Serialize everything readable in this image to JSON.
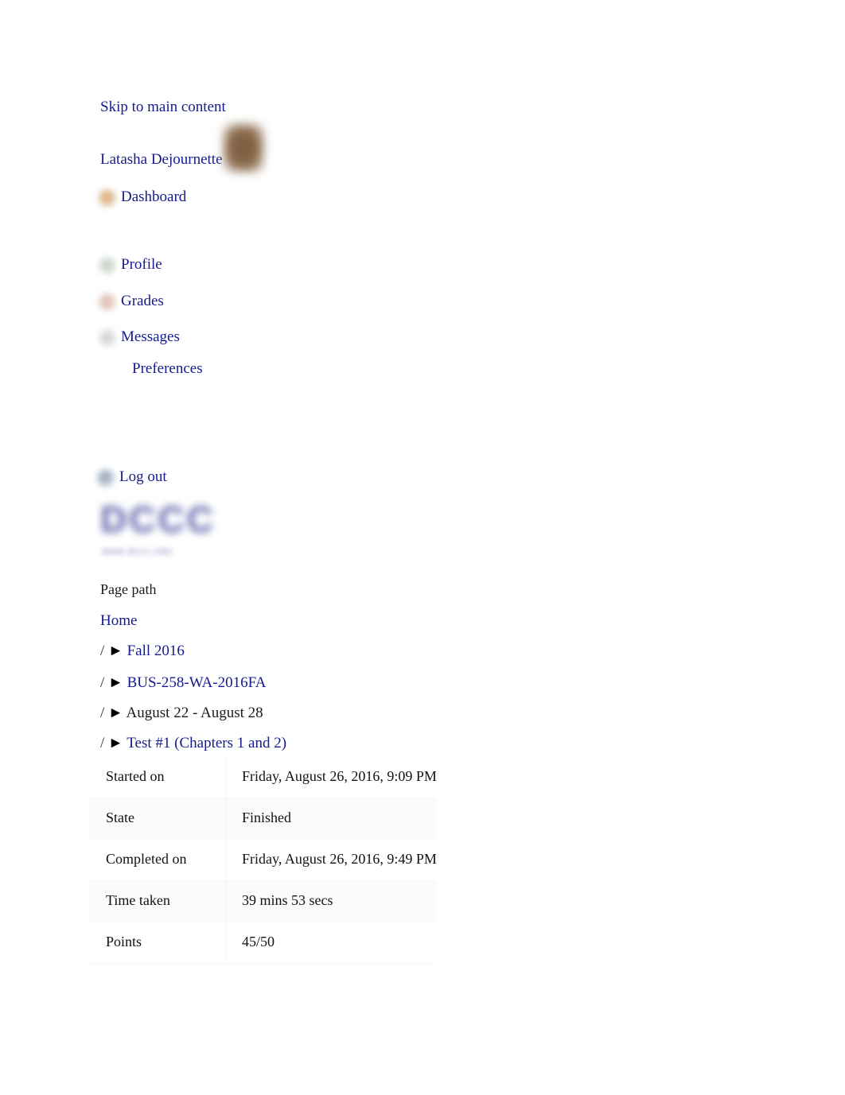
{
  "skip_link": "Skip to main content",
  "user": {
    "name": "Latasha Dejournette",
    "avatar_alt": "user-avatar"
  },
  "nav": {
    "dashboard": "Dashboard",
    "profile": "Profile",
    "grades": "Grades",
    "messages": "Messages",
    "preferences": "Preferences",
    "logout": "Log out"
  },
  "logo": {
    "wordmark": "DCCC",
    "tagline": "www.dccc.edu"
  },
  "breadcrumb": {
    "label": "Page path",
    "items": [
      {
        "sep": "",
        "arrow": "",
        "text": "Home",
        "is_link": true
      },
      {
        "sep": "/",
        "arrow": "►",
        "text": "Fall 2016",
        "is_link": true
      },
      {
        "sep": "/",
        "arrow": "►",
        "text": "BUS-258-WA-2016FA",
        "is_link": true
      },
      {
        "sep": "/",
        "arrow": "►",
        "text": "August 22 - August 28",
        "is_link": false
      },
      {
        "sep": "/",
        "arrow": "►",
        "text": "Test #1 (Chapters 1 and 2)",
        "is_link": true
      }
    ]
  },
  "summary": {
    "rows": [
      {
        "label": "Started on",
        "value": "Friday, August 26, 2016, 9:09 PM"
      },
      {
        "label": "State",
        "value": "Finished"
      },
      {
        "label": "Completed on",
        "value": "Friday, August 26, 2016, 9:49 PM"
      },
      {
        "label": "Time taken",
        "value": "39 mins 53 secs"
      },
      {
        "label": "Points",
        "value": "45/50"
      }
    ]
  },
  "colors": {
    "link": "#151b8d",
    "text": "#1a1a1a",
    "logo": "#5a5fa8"
  }
}
